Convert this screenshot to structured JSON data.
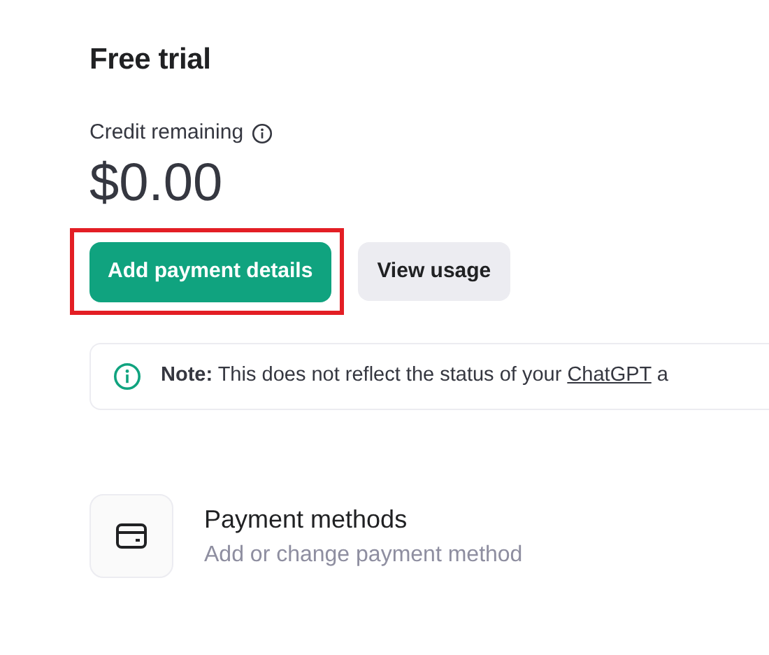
{
  "title": "Free trial",
  "credit": {
    "label": "Credit remaining",
    "amount": "$0.00"
  },
  "buttons": [
    {
      "label": "Add payment details",
      "kind": "primary",
      "highlighted": true
    },
    {
      "label": "View usage",
      "kind": "secondary",
      "highlighted": false
    }
  ],
  "note": {
    "text": "**Note:** This does not reflect the status of your",
    "link": "ChatGPT",
    "after": "a"
  },
  "settings": [
    {
      "title": "Payment methods",
      "subtitle": "Add or change payment method"
    }
  ]
}
